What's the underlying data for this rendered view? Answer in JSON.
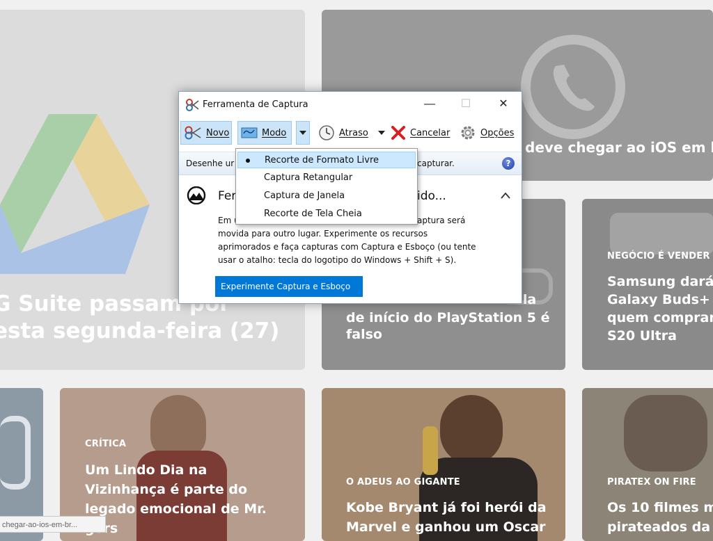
{
  "background": {
    "cards": {
      "gsuite": {
        "title_line1": "G Suite passam por",
        "title_line2": "esta segunda-feira (27)"
      },
      "whatsapp": {
        "title": "deve chegar ao iOS em b"
      },
      "ps5": {
        "title_line0": "ela",
        "title_line1": "de início do PlayStation 5 é",
        "title_line2": "falso"
      },
      "buds": {
        "kicker": "NEGÓCIO É VENDER",
        "title_line1": "Samsung dará",
        "title_line2": "Galaxy Buds+ c",
        "title_line3": "quem comprar",
        "title_line4": "S20 Ultra"
      },
      "lindo": {
        "kicker": "CRÍTICA",
        "title_line1": "Um Lindo Dia na",
        "title_line2": "Vizinhança é parte do",
        "title_line3": "legado emocional de Mr.",
        "title_line4": "gers"
      },
      "kobe": {
        "kicker": "O ADEUS AO GIGANTE",
        "title_line1": "Kobe Bryant já foi herói da",
        "title_line2": "Marvel e ganhou um Oscar"
      },
      "pirat": {
        "kicker": "PIRATEX ON FIRE",
        "title_line1": "Os 10 filmes m",
        "title_line2": "pirateados da s"
      }
    },
    "status_url": "chegar-ao-ios-em-br..."
  },
  "window": {
    "title": "Ferramenta de Captura",
    "controls": {
      "minimize": "—",
      "maximize": "☐",
      "close": "✕"
    },
    "toolbar": {
      "novo": "Novo",
      "modo": "Modo",
      "atraso": "Atraso",
      "cancelar": "Cancelar",
      "opcoes": "Opções"
    },
    "info": {
      "left": "Desenhe ur",
      "right": "capturar.",
      "help": "?"
    },
    "panel": {
      "heading_left": "Fer",
      "heading_right": "ido...",
      "body": {
        "line1_left": "Em u",
        "line1_right": "aptura será",
        "line2_left": "movida para outro lugar. Experimente os recursos",
        "line3": "aprimorados e faça capturas com Captura e Esboço (ou tente",
        "line4": "usar o atalho: tecla do logotipo do Windows + Shift + S)."
      },
      "button": "Experimente Captura e Esboço"
    },
    "menu": {
      "items": [
        {
          "label": "Recorte de Formato Livre",
          "selected": true
        },
        {
          "label": "Captura Retangular",
          "selected": false
        },
        {
          "label": "Captura de Janela",
          "selected": false
        },
        {
          "label": "Recorte de Tela Cheia",
          "selected": false
        }
      ]
    }
  },
  "colors": {
    "accent": "#0078d7",
    "selection": "#cce8ff",
    "cancel_red": "#d81e1e"
  }
}
